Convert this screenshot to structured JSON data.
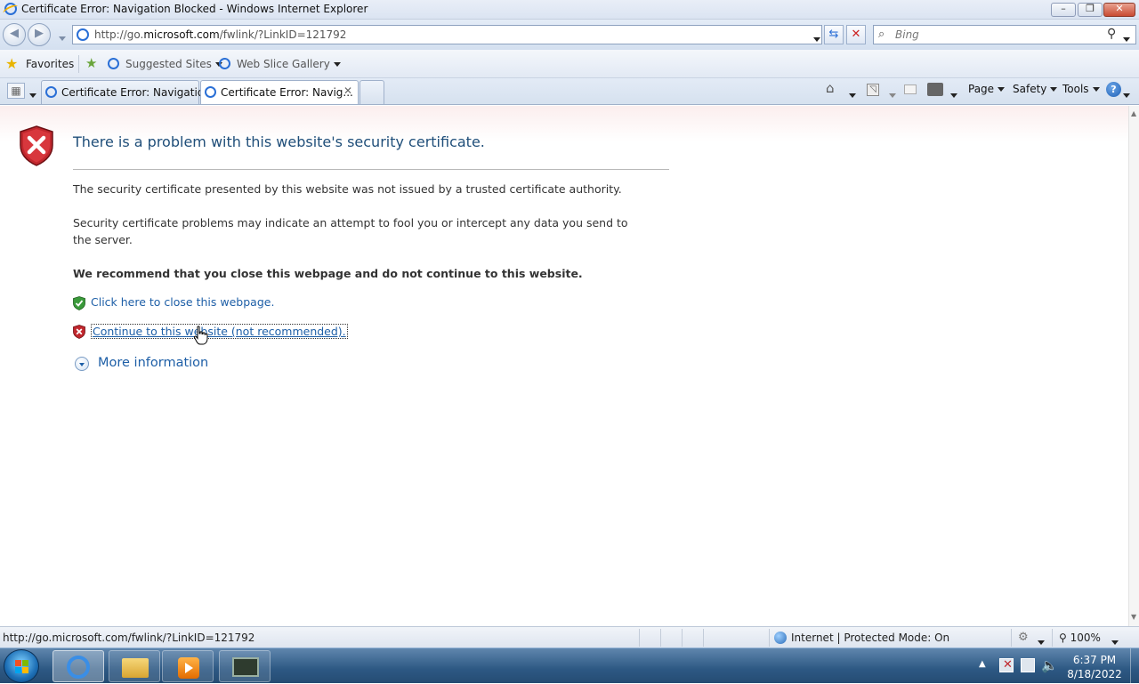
{
  "window": {
    "title": "Certificate Error: Navigation Blocked - Windows Internet Explorer",
    "minimize": "–",
    "restore": "❐",
    "close": "✕"
  },
  "address_bar": {
    "url_prefix": "http://go.",
    "url_domain": "microsoft.com",
    "url_suffix": "/fwlink/?LinkID=121792",
    "refresh_icon": "refresh-icon",
    "stop_icon": "stop-icon"
  },
  "search": {
    "placeholder": "Bing"
  },
  "favorites_bar": {
    "favorites_label": "Favorites",
    "suggested_sites": "Suggested Sites",
    "web_slice_gallery": "Web Slice Gallery"
  },
  "tabs": [
    {
      "label": "Certificate Error: Navigatio...",
      "active": false
    },
    {
      "label": "Certificate Error: Navig...",
      "active": true
    }
  ],
  "command_bar": {
    "page": "Page",
    "safety": "Safety",
    "tools": "Tools",
    "help": "?"
  },
  "content": {
    "heading": "There is a problem with this website's security certificate.",
    "para1": "The security certificate presented by this website was not issued by a trusted certificate authority.",
    "para2": "Security certificate problems may indicate an attempt to fool you or intercept any data you send to the server.",
    "recommendation": "We recommend that you close this webpage and do not continue to this website.",
    "close_link": "Click here to close this webpage.",
    "continue_link": "Continue to this website (not recommended).",
    "more_info": "More information"
  },
  "status_bar": {
    "url": "http://go.microsoft.com/fwlink/?LinkID=121792",
    "zone": "Internet | Protected Mode: On",
    "zoom": "100%"
  },
  "taskbar": {
    "time": "6:37 PM",
    "date": "8/18/2022"
  },
  "colors": {
    "link": "#1e5fa7",
    "heading": "#1f4e79",
    "error_red": "#c0272d",
    "ok_green": "#3a9a3a"
  }
}
